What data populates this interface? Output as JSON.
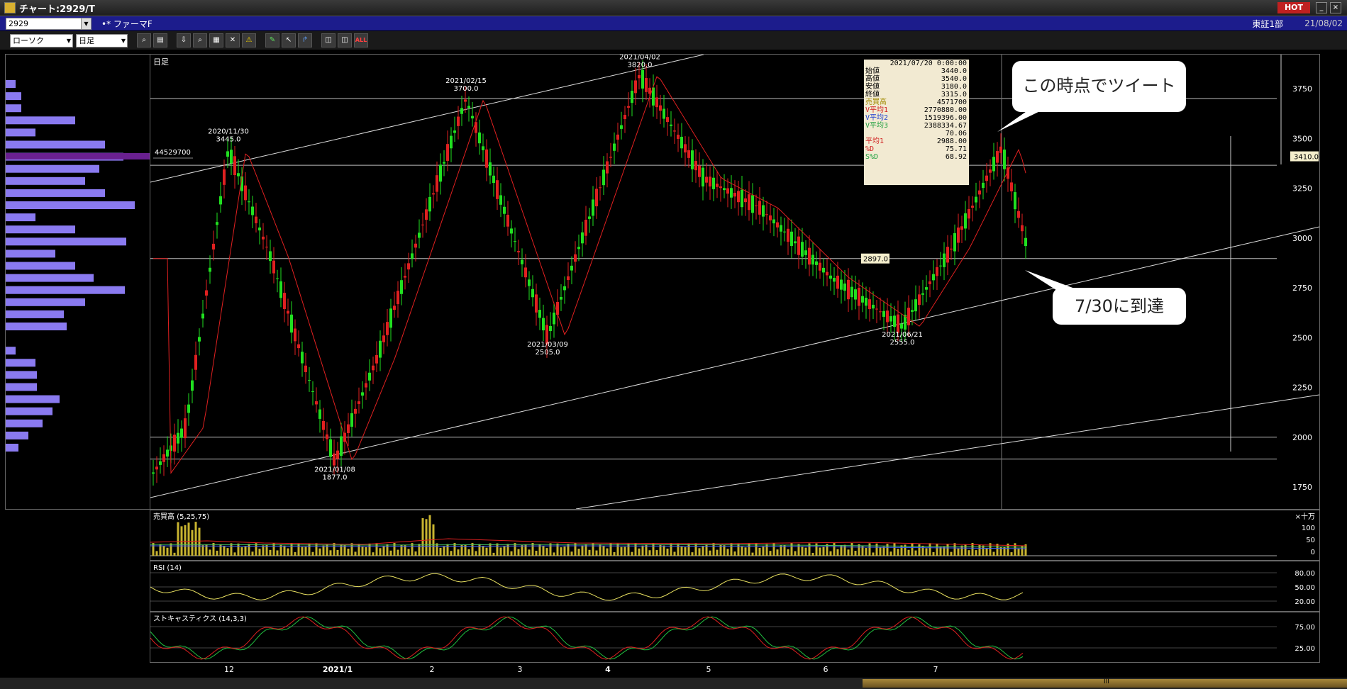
{
  "window": {
    "title": "チャート:2929/T",
    "hot_label": "HOT",
    "min_btn": "_",
    "close_btn": "×"
  },
  "infobar": {
    "code": "2929",
    "name": "•* ファーマF",
    "market": "東証1部",
    "date": "21/08/02"
  },
  "toolbar": {
    "chart_type": "ローソク",
    "period": "日足",
    "buttons": [
      "zoom-icon",
      "window-icon",
      "download-icon",
      "search-icon",
      "grid-icon",
      "cross-icon",
      "warning-icon",
      "pen-icon",
      "cursor-icon",
      "arrow-icon",
      "indicator-a-icon",
      "indicator-b-icon",
      "all-icon"
    ],
    "all_label": "ALL"
  },
  "main_chart": {
    "period_label": "日足",
    "y_ticks": [
      "3750",
      "3500",
      "3250",
      "3000",
      "2750",
      "2500",
      "2250",
      "2000",
      "1750"
    ],
    "price_tag": "3410.0",
    "current_tag": "2897.0",
    "volume_profile_label": "44529700",
    "annotations": [
      {
        "date": "2020/11/30",
        "price": "3445.0"
      },
      {
        "date": "2021/02/15",
        "price": "3700.0"
      },
      {
        "date": "2021/04/02",
        "price": "3820.0"
      },
      {
        "date": "2021/03/09",
        "price": "2505.0"
      },
      {
        "date": "2021/01/08",
        "price": "1877.0"
      },
      {
        "date": "2021/06/21",
        "price": "2555.0"
      }
    ],
    "callouts": {
      "tweet": "この時点でツイート",
      "reached": "7/30に到達"
    }
  },
  "info_box": {
    "datetime": "2021/07/20 0:00:00",
    "rows": [
      {
        "label": "始値",
        "value": "3440.0",
        "color": "#000000"
      },
      {
        "label": "高値",
        "value": "3540.0",
        "color": "#000000"
      },
      {
        "label": "安値",
        "value": "3180.0",
        "color": "#000000"
      },
      {
        "label": "終値",
        "value": "3315.0",
        "color": "#000000"
      },
      {
        "label": "売買高",
        "value": "4571700",
        "color": "#a08a00"
      },
      {
        "label": "V平均1",
        "value": "2770880.00",
        "color": "#d02020"
      },
      {
        "label": "V平均2",
        "value": "1519396.00",
        "color": "#2040d0"
      },
      {
        "label": "V平均3",
        "value": "2388334.67",
        "color": "#20a040"
      },
      {
        "label": "",
        "value": "70.06",
        "color": "#000000"
      },
      {
        "label": "平均1",
        "value": "2988.00",
        "color": "#d02020"
      },
      {
        "label": "%D",
        "value": "75.71",
        "color": "#d02020"
      },
      {
        "label": "S%D",
        "value": "68.92",
        "color": "#20a040"
      }
    ]
  },
  "volume_panel": {
    "label": "売買高 (5,25,75)",
    "unit": "×十万",
    "ticks": [
      "100",
      "50",
      "0"
    ]
  },
  "rsi_panel": {
    "label": "RSI (14)",
    "ticks": [
      "80.00",
      "50.00",
      "20.00"
    ]
  },
  "stoch_panel": {
    "label": "ストキャスティクス (14,3,3)",
    "ticks": [
      "75.00",
      "25.00"
    ]
  },
  "x_axis": [
    "12",
    "2021/1",
    "2",
    "3",
    "4",
    "5",
    "6",
    "7"
  ],
  "bottom_scroll_label": "III"
}
